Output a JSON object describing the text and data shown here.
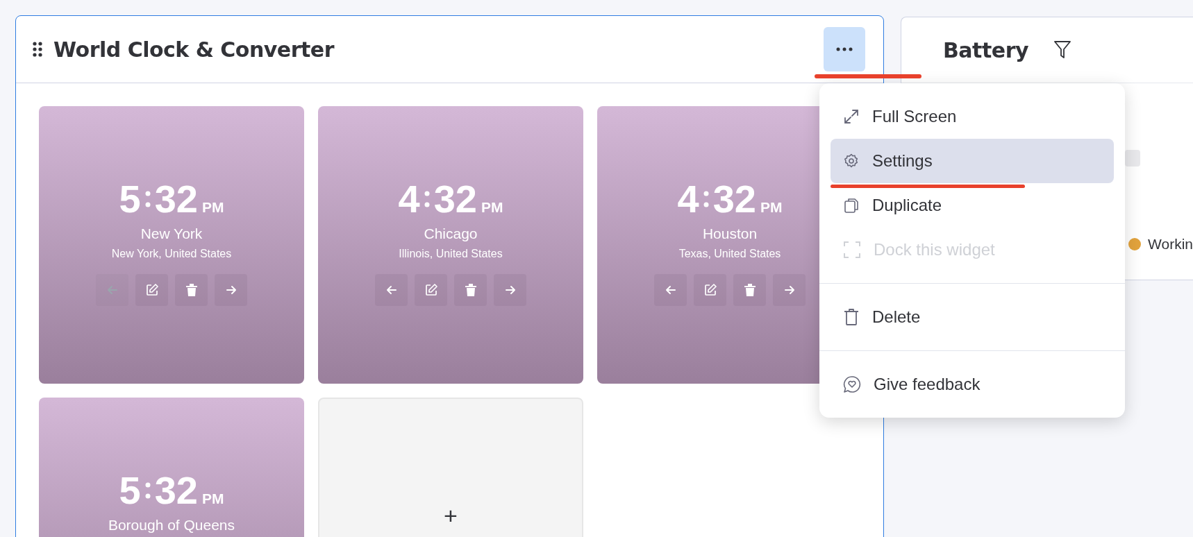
{
  "widget": {
    "title": "World Clock & Converter",
    "clocks": [
      {
        "hour": "5",
        "minutes": "32",
        "period": "PM",
        "city": "New York",
        "region": "New York, United States",
        "actions": [
          {
            "kind": "previous",
            "disabled": true
          },
          {
            "kind": "edit",
            "disabled": false
          },
          {
            "kind": "delete",
            "disabled": false
          },
          {
            "kind": "next",
            "disabled": false
          }
        ]
      },
      {
        "hour": "4",
        "minutes": "32",
        "period": "PM",
        "city": "Chicago",
        "region": "Illinois, United States",
        "actions": [
          {
            "kind": "previous",
            "disabled": false
          },
          {
            "kind": "edit",
            "disabled": false
          },
          {
            "kind": "delete",
            "disabled": false
          },
          {
            "kind": "next",
            "disabled": false
          }
        ]
      },
      {
        "hour": "4",
        "minutes": "32",
        "period": "PM",
        "city": "Houston",
        "region": "Texas, United States",
        "actions": [
          {
            "kind": "previous",
            "disabled": false
          },
          {
            "kind": "edit",
            "disabled": false
          },
          {
            "kind": "delete",
            "disabled": false
          },
          {
            "kind": "next",
            "disabled": false
          }
        ]
      },
      {
        "hour": "5",
        "minutes": "32",
        "period": "PM",
        "city": "Borough of Queens"
      }
    ],
    "add_tile": {
      "label": "+"
    }
  },
  "menu": {
    "groups": [
      [
        {
          "kind": "expand",
          "label": "Full Screen",
          "selected": false,
          "disabled": false
        },
        {
          "kind": "gear",
          "label": "Settings",
          "selected": true,
          "disabled": false
        },
        {
          "kind": "copy",
          "label": "Duplicate",
          "selected": false,
          "disabled": false
        },
        {
          "kind": "dock",
          "label": "Dock this widget",
          "selected": false,
          "disabled": true
        }
      ],
      [
        {
          "kind": "trash",
          "label": "Delete",
          "selected": false,
          "disabled": false
        }
      ],
      [
        {
          "kind": "feedback",
          "label": "Give feedback",
          "selected": false,
          "disabled": false
        }
      ]
    ]
  },
  "battery_panel": {
    "title": "Battery",
    "legend": [
      {
        "label": "Workin",
        "color": "#e2a33d"
      }
    ]
  }
}
